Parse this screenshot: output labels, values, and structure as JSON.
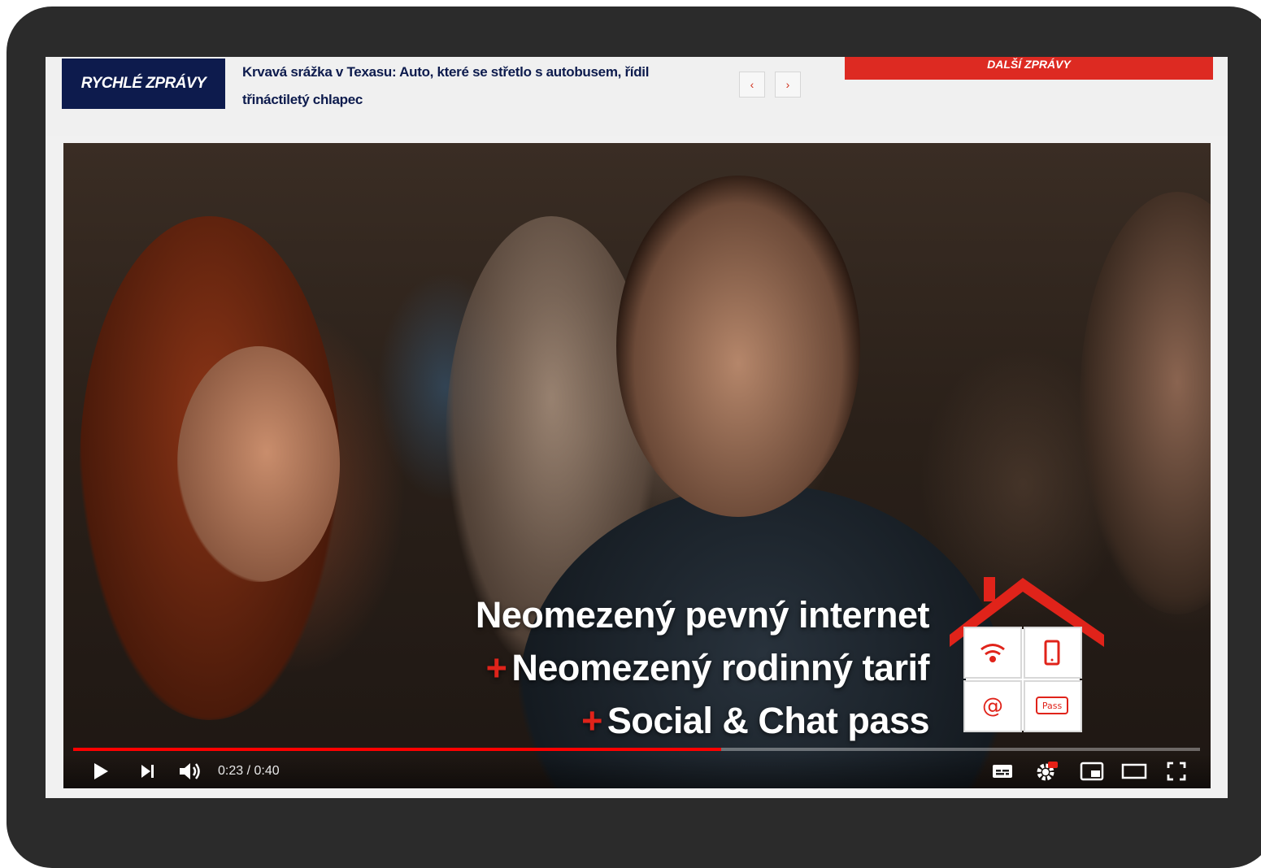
{
  "ticker": {
    "label": "RYCHLÉ ZPRÁVY",
    "headline_line1": "Krvavá srážka v Texasu: Auto, které se střetlo s autobusem, řídil",
    "headline_line2": "třináctiletý chlapec",
    "prev_symbol": "‹",
    "next_symbol": "›",
    "more_button": "DALŠÍ ZPRÁVY"
  },
  "video": {
    "promo_line1": "Neomezený pevný internet",
    "promo_line2": "Neomezený rodinný tarif",
    "promo_line3": "Social & Chat pass",
    "plus": "+",
    "pass_label": "Pass",
    "current_time": "0:23",
    "duration": "0:40",
    "time_display": "0:23 / 0:40",
    "progress_fraction": 0.575
  },
  "icons": {
    "play": "play-icon",
    "next": "next-icon",
    "volume": "volume-icon",
    "subtitles": "subtitles-icon",
    "settings": "settings-icon",
    "miniplayer": "miniplayer-icon",
    "theater": "theater-icon",
    "fullscreen": "fullscreen-icon"
  },
  "colors": {
    "ticker_label_bg": "#0d1b4d",
    "accent_red": "#dd2a22",
    "progress_red": "#ff0000"
  }
}
